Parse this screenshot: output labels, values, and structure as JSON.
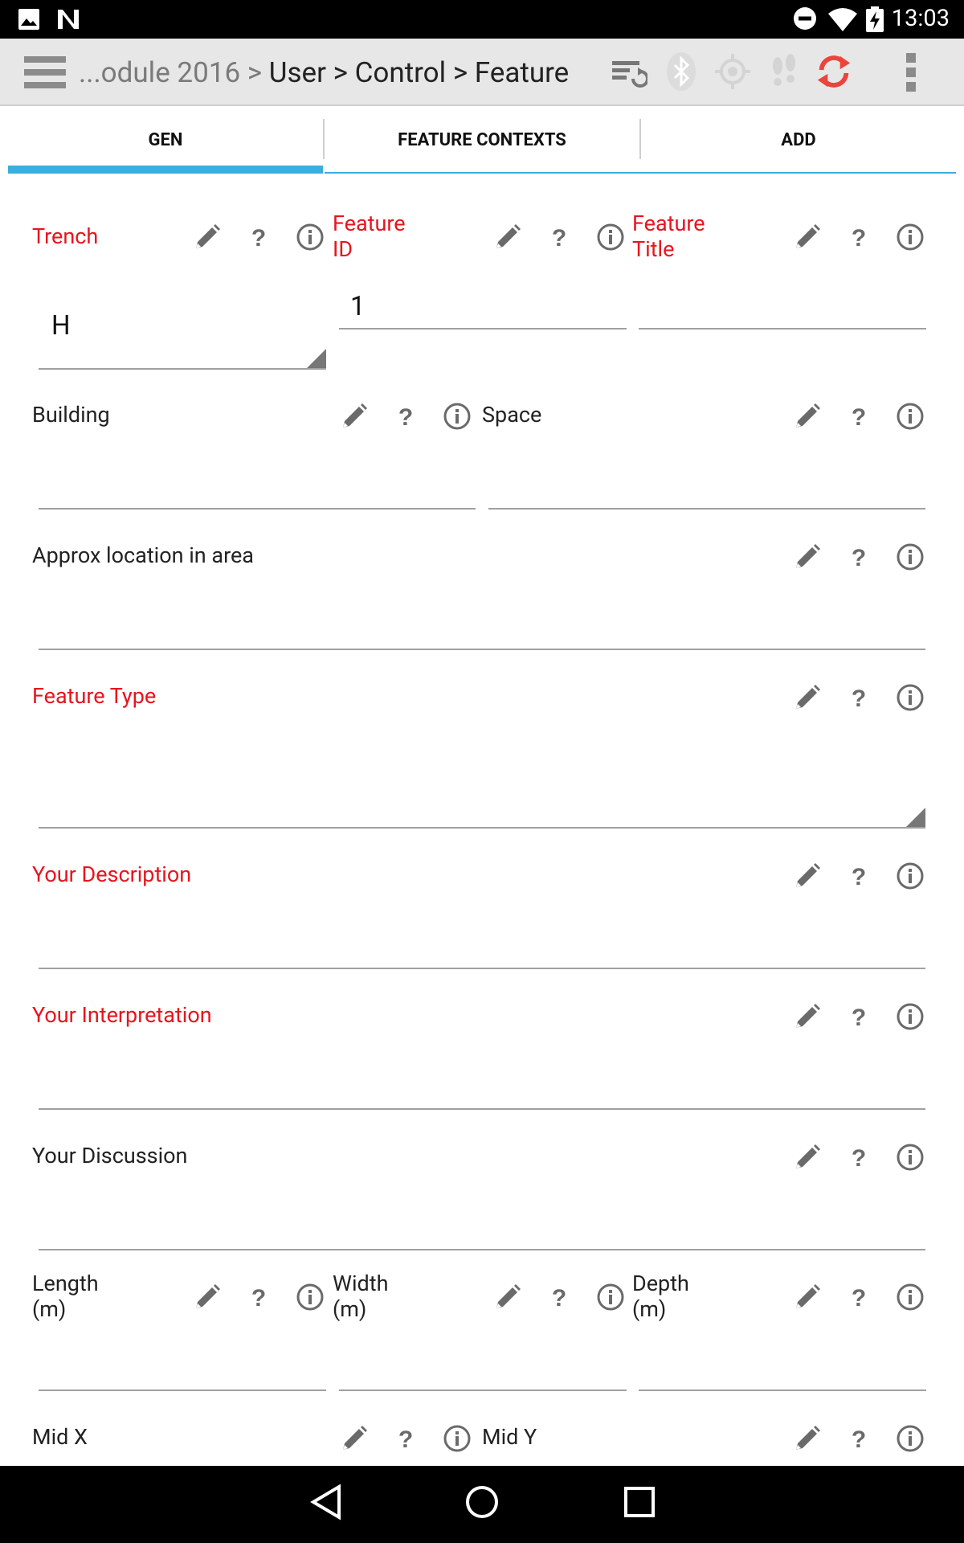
{
  "status": {
    "time": "13:03"
  },
  "appbar": {
    "breadcrumb_prefix": "...odule 2016 > ",
    "breadcrumb_path": "User > Control > Feature"
  },
  "tabs": [
    "GEN",
    "FEATURE CONTEXTS",
    "ADD"
  ],
  "form": {
    "trench": {
      "label": "Trench",
      "value": "H"
    },
    "feature_id": {
      "label": "Feature\nID",
      "value": "1"
    },
    "feature_title": {
      "label": "Feature\nTitle",
      "value": ""
    },
    "building": {
      "label": "Building",
      "value": ""
    },
    "space": {
      "label": "Space",
      "value": ""
    },
    "approx_location": {
      "label": "Approx location in area",
      "value": ""
    },
    "feature_type": {
      "label": "Feature Type",
      "value": ""
    },
    "your_description": {
      "label": "Your Description",
      "value": ""
    },
    "your_interpretation": {
      "label": "Your Interpretation",
      "value": ""
    },
    "your_discussion": {
      "label": "Your Discussion",
      "value": ""
    },
    "length": {
      "label": "Length\n(m)",
      "value": ""
    },
    "width": {
      "label": "Width\n(m)",
      "value": ""
    },
    "depth": {
      "label": "Depth\n(m)",
      "value": ""
    },
    "mid_x": {
      "label": "Mid X",
      "value": ""
    },
    "mid_y": {
      "label": "Mid Y",
      "value": ""
    }
  },
  "colors": {
    "required_label": "#e8141e",
    "tab_indicator": "#3aaee0",
    "sync_icon": "#e8453c"
  },
  "icons": [
    "pencil-icon",
    "help-icon",
    "info-icon"
  ]
}
